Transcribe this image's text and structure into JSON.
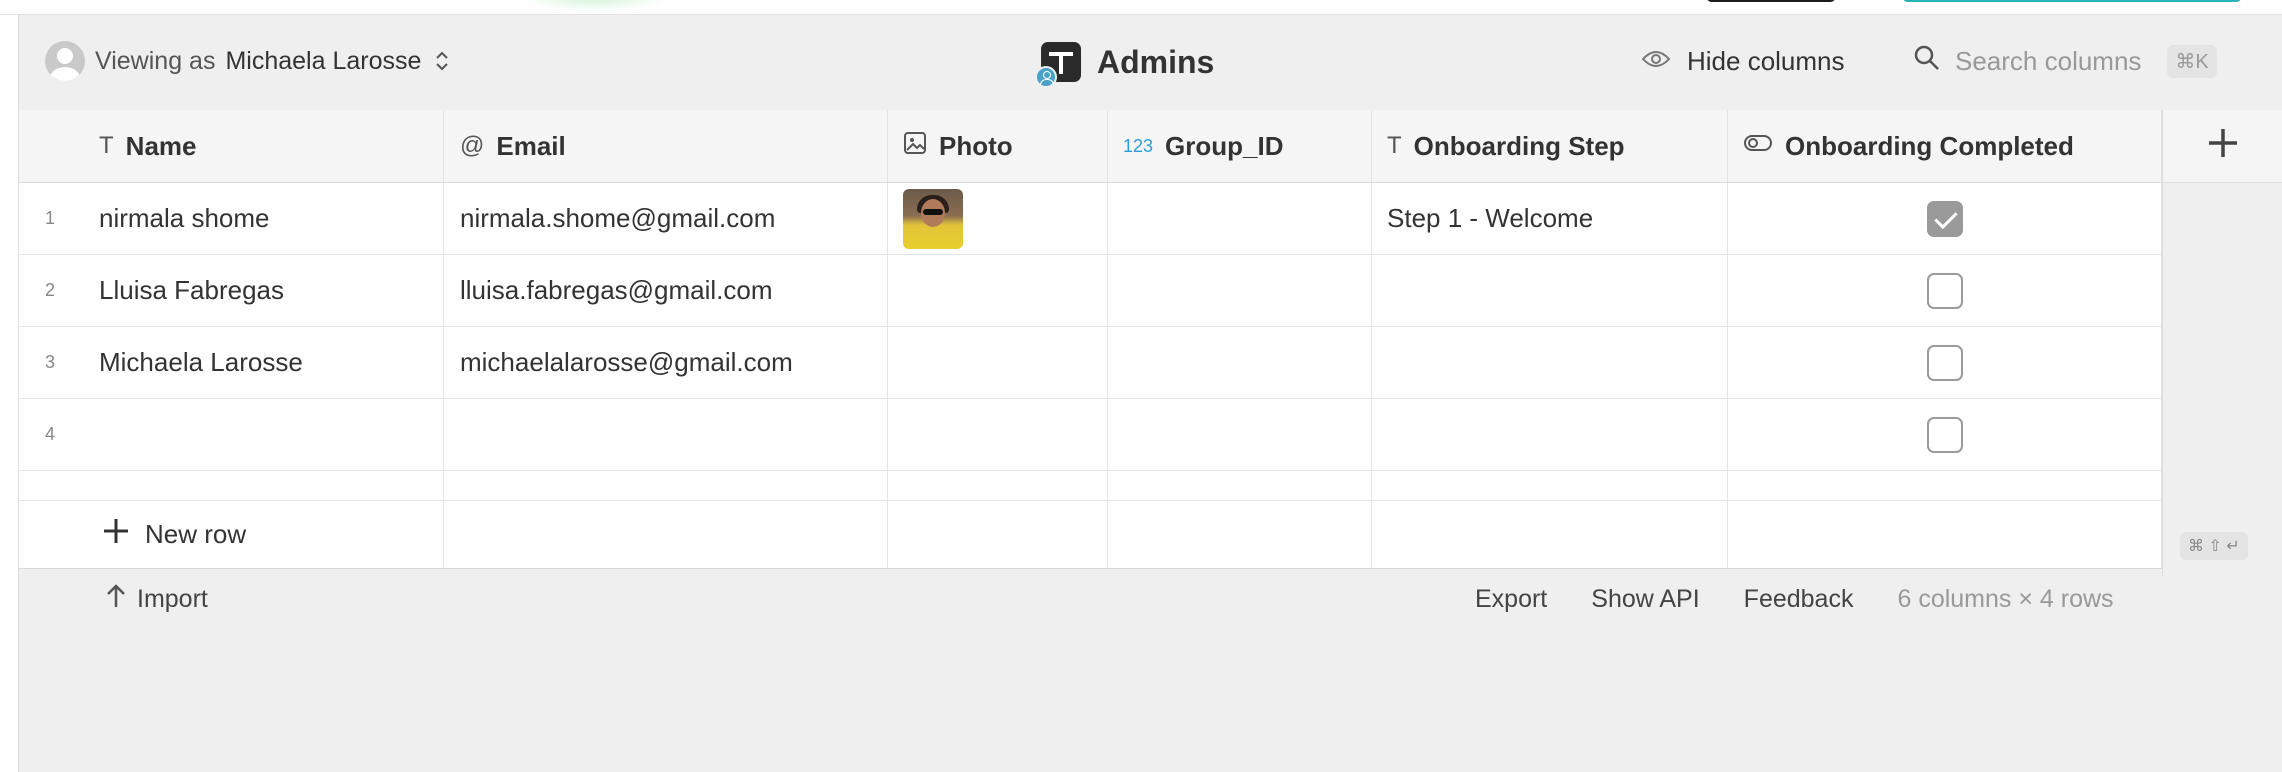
{
  "header": {
    "viewing_prefix": "Viewing as",
    "viewing_user": "Michaela Larosse",
    "title": "Admins",
    "hide_columns": "Hide columns",
    "search_placeholder": "Search columns",
    "search_shortcut": "⌘K"
  },
  "columns": [
    {
      "icon": "text-type-icon",
      "glyph": "T",
      "label": "Name"
    },
    {
      "icon": "at-sign-icon",
      "glyph": "@",
      "label": "Email"
    },
    {
      "icon": "image-icon",
      "glyph": "▨",
      "label": "Photo"
    },
    {
      "icon": "number-type-icon",
      "glyph": "123",
      "label": "Group_ID"
    },
    {
      "icon": "text-type-icon",
      "glyph": "T",
      "label": "Onboarding Step"
    },
    {
      "icon": "toggle-icon",
      "glyph": "⊂⊃",
      "label": "Onboarding Completed"
    }
  ],
  "rows": [
    {
      "num": "1",
      "name": "nirmala shome",
      "email": "nirmala.shome@gmail.com",
      "photo": true,
      "group_id": "",
      "step": "Step 1 - Welcome",
      "completed": true
    },
    {
      "num": "2",
      "name": "Lluisa Fabregas",
      "email": "lluisa.fabregas@gmail.com",
      "photo": false,
      "group_id": "",
      "step": "",
      "completed": false
    },
    {
      "num": "3",
      "name": "Michaela Larosse",
      "email": "michaelalarosse@gmail.com",
      "photo": false,
      "group_id": "",
      "step": "",
      "completed": false
    },
    {
      "num": "4",
      "name": "",
      "email": "",
      "photo": false,
      "group_id": "",
      "step": "",
      "completed": false
    }
  ],
  "new_row_label": "New row",
  "new_row_shortcut": "⌘ ⇧ ↵",
  "add_column_glyph": "+",
  "footer": {
    "import": "Import",
    "export": "Export",
    "show_api": "Show API",
    "feedback": "Feedback",
    "count": "6 columns × 4 rows"
  }
}
